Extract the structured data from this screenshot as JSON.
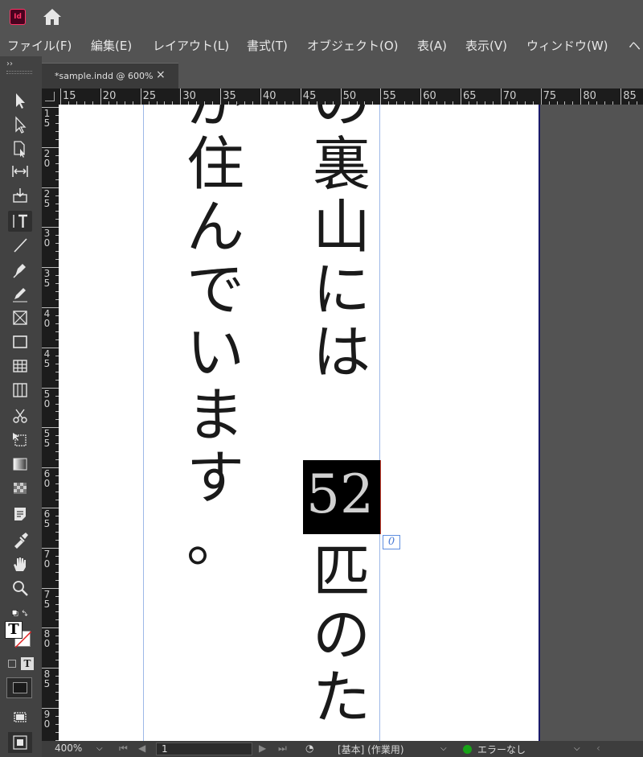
{
  "app": {
    "icon_label": "Id",
    "accent": "#ff3366"
  },
  "menu": [
    "ファイル(F)",
    "編集(E)",
    "レイアウト(L)",
    "書式(T)",
    "オブジェクト(O)",
    "表(A)",
    "表示(V)",
    "ウィンドウ(W)",
    "ヘ"
  ],
  "document_tab": {
    "title": "*sample.indd @ 600%",
    "close": "×"
  },
  "ruler": {
    "h_labels": [
      "15",
      "20",
      "25",
      "30",
      "35",
      "40",
      "45",
      "50",
      "55",
      "60",
      "65",
      "70",
      "75",
      "80",
      "85"
    ],
    "v_labels": [
      "1\n5",
      "2\n0",
      "2\n5",
      "3\n0",
      "3\n5",
      "4\n0",
      "4\n5",
      "5\n0",
      "5\n5",
      "6\n0",
      "6\n5",
      "7\n0",
      "7\n5",
      "8\n0",
      "8\n5",
      "9\n0"
    ]
  },
  "canvas": {
    "column_right": [
      "の",
      "裏",
      "山",
      "に",
      "は"
    ],
    "selected_text": "52",
    "column_right_after": [
      "匹",
      "の",
      "た"
    ],
    "column_left": [
      "が",
      "住",
      "ん",
      "で",
      "い",
      "ま",
      "す",
      "。"
    ],
    "overset_marker": "0"
  },
  "tools": [
    "selection-tool-icon",
    "direct-selection-tool-icon",
    "page-tool-icon",
    "gap-tool-icon",
    "content-collector-icon",
    "vertical-type-tool-icon",
    "line-tool-icon",
    "pen-tool-icon",
    "pencil-tool-icon",
    "rectangle-frame-tool-icon",
    "rectangle-tool-icon",
    "table-icon",
    "table-columns-icon",
    "scissors-tool-icon",
    "free-transform-tool-icon",
    "gradient-swatch-tool-icon",
    "gradient-feather-tool-icon",
    "note-tool-icon",
    "eyedropper-tool-icon",
    "hand-tool-icon",
    "zoom-tool-icon"
  ],
  "status": {
    "zoom": "400%",
    "page": "1",
    "preflight_profile": "[基本] (作業用)",
    "error_status": "エラーなし",
    "error_color": "#17a317"
  }
}
